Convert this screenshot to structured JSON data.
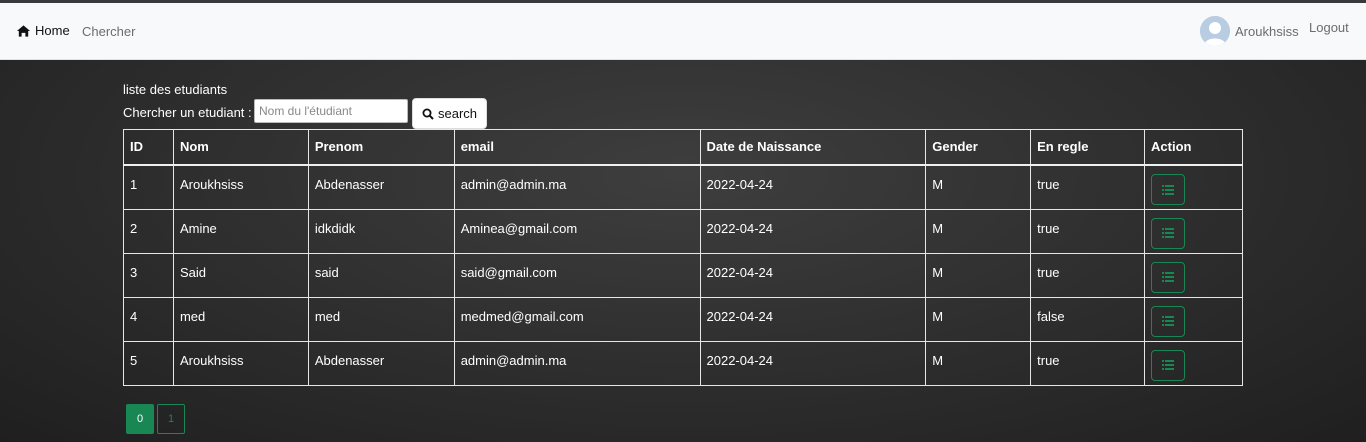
{
  "nav": {
    "home_label": "Home",
    "search_link": "Chercher",
    "user_name": "Aroukhsiss",
    "logout_label": "Logout",
    "home_icon": "house-icon",
    "avatar_icon": "user-avatar-icon"
  },
  "page": {
    "title": "liste des etudiants",
    "search_label": "Chercher un etudiant :",
    "search_placeholder": "Nom du l'étudiant",
    "search_value": "",
    "search_button": "search",
    "search_icon": "magnifier-icon"
  },
  "table": {
    "headers": [
      "ID",
      "Nom",
      "Prenom",
      "email",
      "Date de Naissance",
      "Gender",
      "En regle",
      "Action"
    ],
    "rows": [
      {
        "id": "1",
        "nom": "Aroukhsiss",
        "prenom": "Abdenasser",
        "email": "admin@admin.ma",
        "date": "2022-04-24",
        "gender": "M",
        "en_regle": "true"
      },
      {
        "id": "2",
        "nom": "Amine",
        "prenom": "idkdidk",
        "email": "Aminea@gmail.com",
        "date": "2022-04-24",
        "gender": "M",
        "en_regle": "true"
      },
      {
        "id": "3",
        "nom": "Said",
        "prenom": "said",
        "email": "said@gmail.com",
        "date": "2022-04-24",
        "gender": "M",
        "en_regle": "true"
      },
      {
        "id": "4",
        "nom": "med",
        "prenom": "med",
        "email": "medmed@gmail.com",
        "date": "2022-04-24",
        "gender": "M",
        "en_regle": "false"
      },
      {
        "id": "5",
        "nom": "Aroukhsiss",
        "prenom": "Abdenasser",
        "email": "admin@admin.ma",
        "date": "2022-04-24",
        "gender": "M",
        "en_regle": "true"
      }
    ],
    "action_icon": "list-icon"
  },
  "pagination": {
    "pages": [
      "0",
      "1"
    ],
    "active": "0"
  },
  "colors": {
    "accent": "#198754",
    "navbar_bg": "#f8f9fa",
    "page_bg": "#2d2d2d"
  }
}
